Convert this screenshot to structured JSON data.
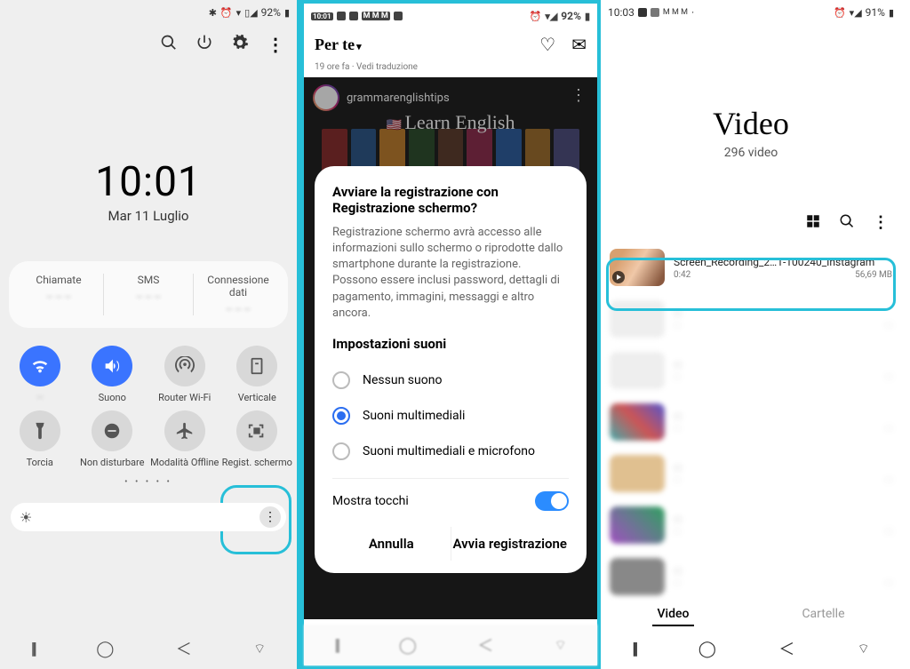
{
  "phone1": {
    "status": {
      "time": "",
      "battery": "92%"
    },
    "clock": {
      "time": "10:01",
      "date": "Mar 11 Luglio"
    },
    "cards": [
      {
        "title": "Chiamate"
      },
      {
        "title": "SMS"
      },
      {
        "title": "Connessione dati"
      }
    ],
    "qs": [
      {
        "label": "",
        "name": "wifi"
      },
      {
        "label": "Suono",
        "name": "sound"
      },
      {
        "label": "Router Wi-Fi",
        "name": "hotspot"
      },
      {
        "label": "Verticale",
        "name": "rotation"
      },
      {
        "label": "Torcia",
        "name": "torch"
      },
      {
        "label": "Non disturbare",
        "name": "dnd"
      },
      {
        "label": "Modalità Offline",
        "name": "airplane"
      },
      {
        "label": "Regist. schermo",
        "name": "screenrec"
      }
    ]
  },
  "phone2": {
    "status": {
      "time": "10:01",
      "battery": "92%"
    },
    "tab": "Per te",
    "meta": "19 ore fa · Vedi traduzione",
    "reel": {
      "user": "grammarenglishtips",
      "title": "Learn English"
    },
    "dialog": {
      "title": "Avviare la registrazione con Registrazione schermo?",
      "desc": "Registrazione schermo avrà accesso alle informazioni sullo schermo o riprodotte dallo smartphone durante la registrazione. Possono essere inclusi password, dettagli di pagamento, immagini, messaggi e altro ancora.",
      "sound_heading": "Impostazioni suoni",
      "options": {
        "none": "Nessun suono",
        "media": "Suoni multimediali",
        "media_mic": "Suoni multimediali e microfono"
      },
      "show_touches": "Mostra tocchi",
      "cancel": "Annulla",
      "start": "Avvia registrazione"
    }
  },
  "phone3": {
    "status": {
      "time": "10:03",
      "battery": "91%"
    },
    "title": "Video",
    "count": "296 video",
    "video": {
      "name": "Screen_Recording_2…1-100240_Instagram",
      "dur": "0:42",
      "size": "56,69 MB"
    },
    "tabs": {
      "videos": "Video",
      "folders": "Cartelle"
    }
  }
}
